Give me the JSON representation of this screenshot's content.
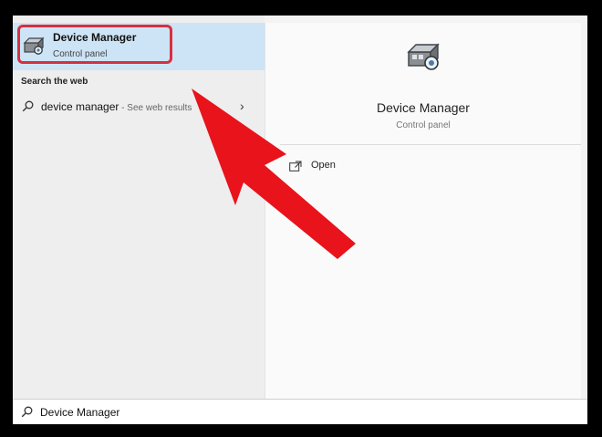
{
  "results": {
    "best_match": {
      "title": "Device Manager",
      "subtitle": "Control panel",
      "icon": "device-manager-icon"
    },
    "web_section_heading": "Search the web",
    "web_result": {
      "query": "device manager",
      "suffix": " - See web results",
      "icon": "search-icon",
      "chevron": "›"
    }
  },
  "preview": {
    "title": "Device Manager",
    "subtitle": "Control panel",
    "actions": [
      {
        "label": "Open",
        "icon": "open-icon"
      }
    ]
  },
  "search_bar": {
    "value": "Device Manager",
    "icon": "search-icon"
  },
  "annotation": {
    "highlight_color": "#d6303f",
    "arrow_color": "#e8131b"
  }
}
